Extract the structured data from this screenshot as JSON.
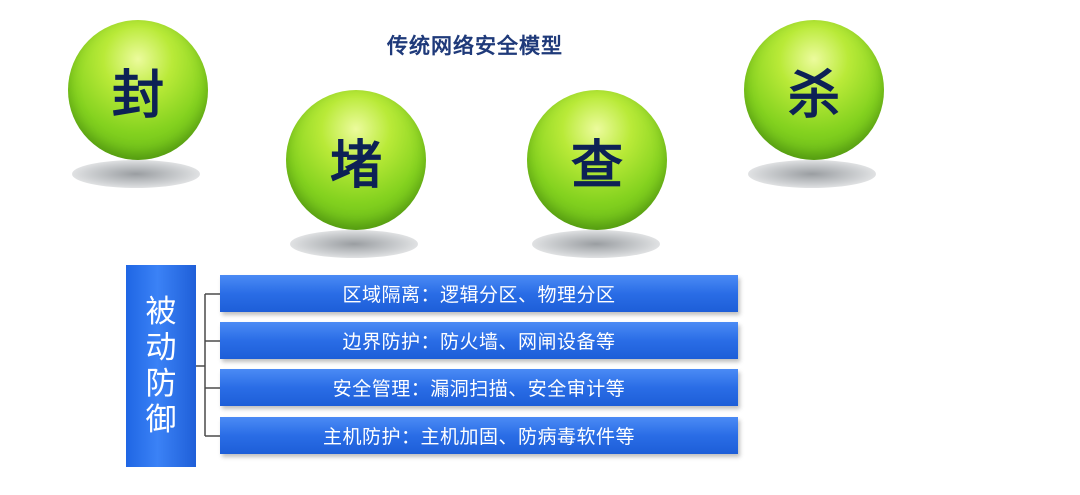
{
  "title": "传统网络安全模型",
  "circles": [
    {
      "label": "封"
    },
    {
      "label": "堵"
    },
    {
      "label": "查"
    },
    {
      "label": "杀"
    }
  ],
  "passive_defense": {
    "chars": [
      "被",
      "动",
      "防",
      "御"
    ],
    "items": [
      "区域隔离：逻辑分区、物理分区",
      "边界防护：防火墙、网闸设备等",
      "安全管理：漏洞扫描、安全审计等",
      "主机防护：主机加固、防病毒软件等"
    ]
  },
  "colors": {
    "title": "#1f3a7a",
    "circle_green": "#84d21f",
    "circle_text": "#0d2155",
    "bar_blue": "#2a6de6"
  }
}
